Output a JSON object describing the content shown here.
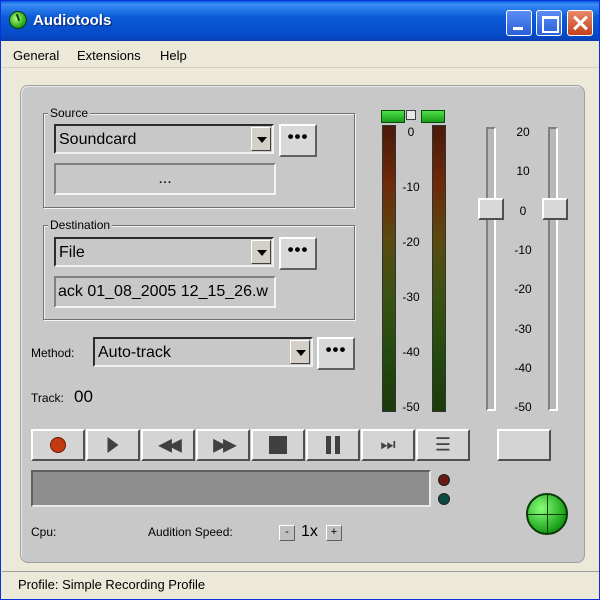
{
  "window": {
    "title": "Audiotools",
    "icon": "audiotools-logo-icon"
  },
  "menu": {
    "items": [
      "General",
      "Extensions",
      "Help"
    ]
  },
  "source": {
    "group_label": "Source",
    "selected": "Soundcard",
    "dots_label": "•••",
    "detail": "..."
  },
  "destination": {
    "group_label": "Destination",
    "selected": "File",
    "dots_label": "•••",
    "filename": "ack 01_08_2005 12_15_26.w"
  },
  "method": {
    "label": "Method:",
    "selected": "Auto-track",
    "dots_label": "•••"
  },
  "track": {
    "label": "Track:",
    "value": "00"
  },
  "meter_scale": [
    "0",
    "-10",
    "-20",
    "-30",
    "-40",
    "-50"
  ],
  "slider_scale": [
    "20",
    "10",
    "0",
    "-10",
    "-20",
    "-30",
    "-40",
    "-50"
  ],
  "slider_value_db": 0,
  "transport": {
    "buttons": [
      "record",
      "play",
      "rewind",
      "fast-forward",
      "stop",
      "pause",
      "skip-to-end",
      "list"
    ],
    "record_color": "#c43a10"
  },
  "cpu": {
    "label": "Cpu:"
  },
  "audition": {
    "label": "Audition Speed:",
    "minus": "-",
    "value": "1x",
    "plus": "+"
  },
  "leds": {
    "top_color": "#6a1a12",
    "bottom_color": "#0a4a40"
  },
  "status": {
    "text": "Profile: Simple Recording Profile"
  }
}
